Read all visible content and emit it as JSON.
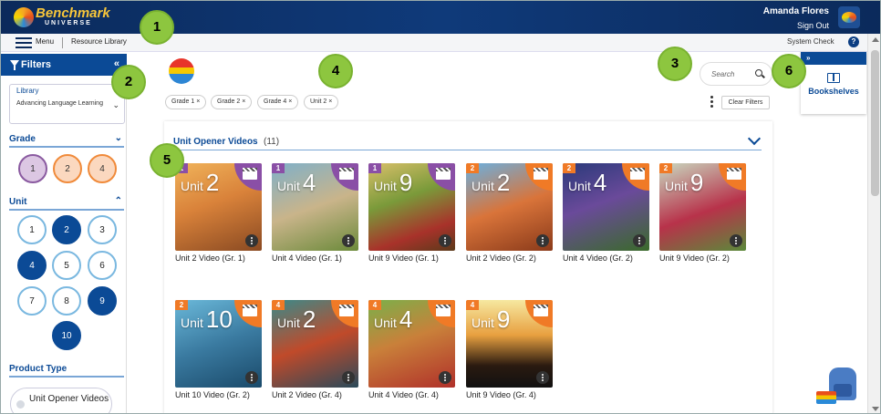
{
  "brand": {
    "name": "Benchmark",
    "sub": "UNIVERSE"
  },
  "user": {
    "name": "Amanda Flores",
    "sign_out": "Sign Out"
  },
  "nav": {
    "menu": "Menu",
    "resource_library": "Resource Library",
    "system_check": "System Check",
    "help": "?"
  },
  "sidebar": {
    "title": "Filters",
    "collapse": "«",
    "library_label": "Library",
    "library_value": "Advancing Language Learning",
    "grade_label": "Grade",
    "grades": [
      "1",
      "2",
      "4"
    ],
    "unit_label": "Unit",
    "units": [
      "1",
      "2",
      "3",
      "4",
      "5",
      "6",
      "7",
      "8",
      "9",
      "10"
    ],
    "units_selected": [
      "2",
      "4",
      "9",
      "10"
    ],
    "product_type_label": "Product Type",
    "product_type_option": "Unit Opener Videos"
  },
  "chips": [
    "Grade 1",
    "Grade 2",
    "Grade 4",
    "Unit 2"
  ],
  "chip_close": "×",
  "clear_filters": "Clear Filters",
  "search": {
    "placeholder": "Search"
  },
  "bookshelves": {
    "toggle": "»",
    "label": "Bookshelves"
  },
  "section": {
    "title": "Unit Opener Videos",
    "count": "(11)"
  },
  "unit_word": "Unit",
  "colors": {
    "grade1": "#8a4fa6",
    "grade2": "#f07a26",
    "grade4": "#f07a26",
    "brand_blue": "#0b4a96",
    "marker_green": "#8dc63f"
  },
  "videos": [
    {
      "grade": "1",
      "unit": "2",
      "caption": "Unit 2 Video (Gr. 1)"
    },
    {
      "grade": "1",
      "unit": "4",
      "caption": "Unit 4 Video (Gr. 1)"
    },
    {
      "grade": "1",
      "unit": "9",
      "caption": "Unit 9 Video (Gr. 1)"
    },
    {
      "grade": "2",
      "unit": "2",
      "caption": "Unit 2 Video (Gr. 2)"
    },
    {
      "grade": "2",
      "unit": "4",
      "caption": "Unit 4 Video (Gr. 2)"
    },
    {
      "grade": "2",
      "unit": "9",
      "caption": "Unit 9 Video (Gr. 2)"
    },
    {
      "grade": "2",
      "unit": "10",
      "caption": "Unit 10 Video (Gr. 2)"
    },
    {
      "grade": "4",
      "unit": "2",
      "caption": "Unit 2 Video (Gr. 4)"
    },
    {
      "grade": "4",
      "unit": "4",
      "caption": "Unit 4 Video (Gr. 4)"
    },
    {
      "grade": "4",
      "unit": "9",
      "caption": "Unit 9 Video (Gr. 4)"
    }
  ],
  "markers": [
    "1",
    "2",
    "3",
    "4",
    "5",
    "6"
  ]
}
